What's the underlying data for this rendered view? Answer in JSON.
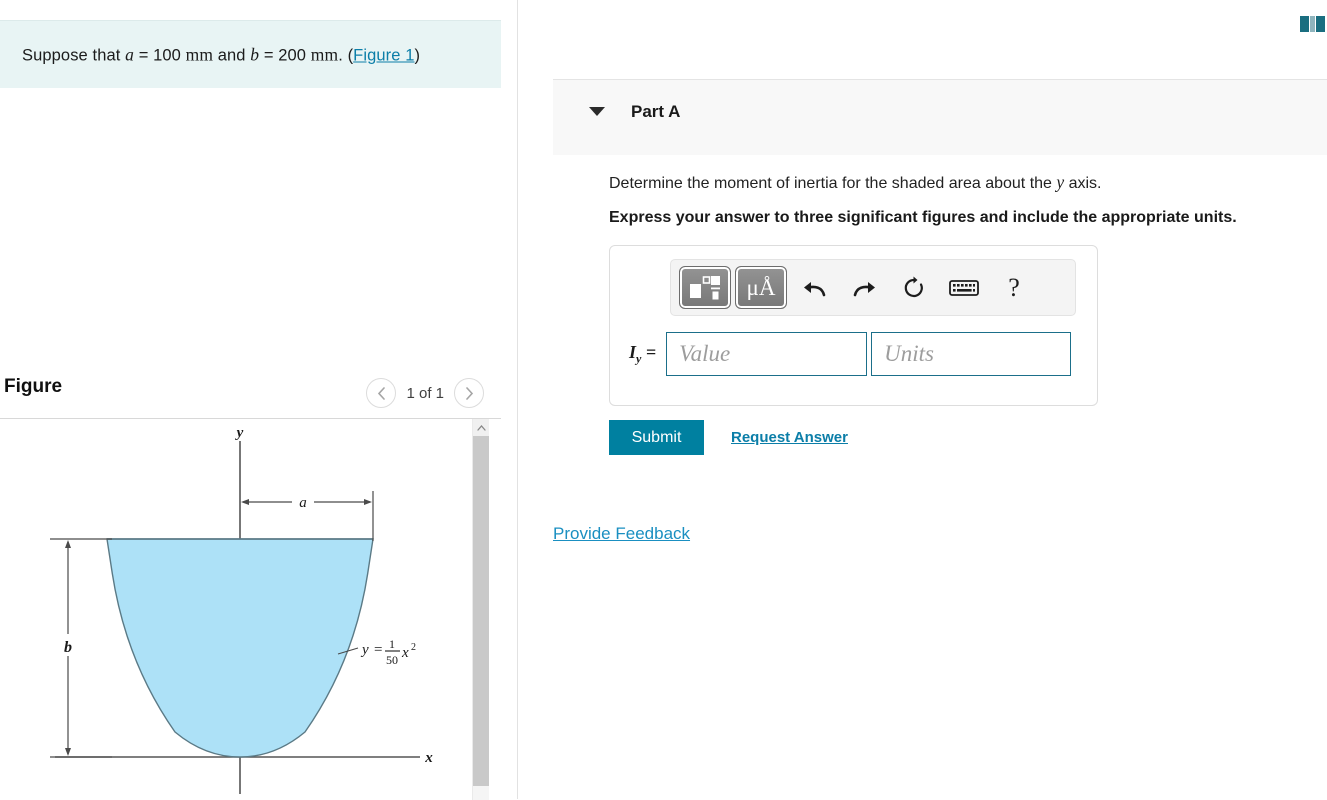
{
  "problem": {
    "prefix": "Suppose that",
    "var_a": "a",
    "eq1": "= 100",
    "unit_a": "mm",
    "conj": "and",
    "var_b": "b",
    "eq2": "= 200",
    "unit_b": "mm",
    "period": ". (",
    "figure_link": "Figure 1",
    "close_paren": ")"
  },
  "figure": {
    "title": "Figure",
    "pager_label": "1 of 1",
    "prev_icon": "chevron-left-icon",
    "next_icon": "chevron-right-icon",
    "scroll_up_icon": "caret-up-icon",
    "diagram": {
      "y_axis_label": "y",
      "x_axis_label": "x",
      "dim_a_label": "a",
      "dim_b_label": "b",
      "curve_equation_y": "y",
      "curve_equation_eq": "=",
      "curve_equation_num": "1",
      "curve_equation_den": "50",
      "curve_equation_x": "x",
      "curve_equation_pow": "2",
      "fill_color": "#ade1f7",
      "outline_color": "#5b7a86",
      "axis_color": "#555555"
    }
  },
  "part": {
    "caret_icon": "caret-down-icon",
    "title": "Part A",
    "question": "Determine the moment of inertia for the shaded area about the ",
    "question_var": "y",
    "question_tail": " axis.",
    "instruction": "Express your answer to three significant figures and include the appropriate units."
  },
  "toolbar": {
    "template_icon": "math-template-icon",
    "units_icon": "units-micro-angstrom-icon",
    "units_label": "μÅ",
    "undo_icon": "undo-arrow-icon",
    "redo_icon": "redo-arrow-icon",
    "reset_icon": "reset-circular-arrow-icon",
    "keyboard_icon": "keyboard-icon",
    "help_icon": "help-question-icon",
    "help_label": "?"
  },
  "answer": {
    "label_symbol": "I",
    "label_sub": "y",
    "label_equals": " =",
    "value_placeholder": "Value",
    "units_placeholder": "Units",
    "value": "",
    "units": ""
  },
  "actions": {
    "submit_label": "Submit",
    "request_answer_label": "Request Answer",
    "provide_feedback_label": "Provide Feedback"
  },
  "topbar": {
    "icon": "book-teal-icon"
  },
  "colors": {
    "accent_teal": "#0080a0",
    "link_blue": "#0b7ea8",
    "problem_bg": "#e8f4f4",
    "panel_bg": "#f8f8f8",
    "figure_fill": "#ade1f7"
  }
}
